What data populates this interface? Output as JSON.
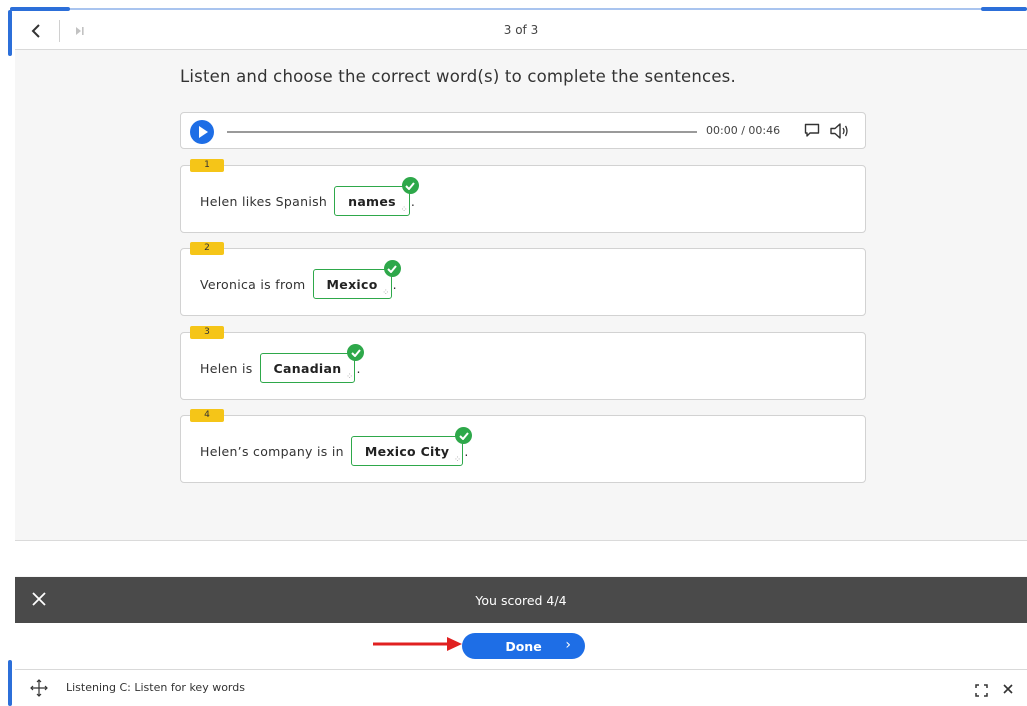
{
  "nav": {
    "back_icon": "chevron-left-icon",
    "skip_icon": "skip-forward-icon",
    "counter": "3 of 3"
  },
  "instruction": "Listen and choose the correct word(s) to complete the sentences.",
  "audio": {
    "time": "00:00 / 00:46",
    "progress": 0,
    "play_icon": "play-icon",
    "subtitle_icon": "subtitles-icon",
    "volume_icon": "volume-icon"
  },
  "questions": [
    {
      "number": "1",
      "prefix": "Helen likes Spanish",
      "answer": "names",
      "suffix": ".",
      "correct": true
    },
    {
      "number": "2",
      "prefix": "Veronica is from",
      "answer": "Mexico",
      "suffix": ".",
      "correct": true
    },
    {
      "number": "3",
      "prefix": "Helen is",
      "answer": "Canadian",
      "suffix": ".",
      "correct": true
    },
    {
      "number": "4",
      "prefix": "Helen’s company is in",
      "answer": "Mexico City",
      "suffix": ".",
      "correct": true
    }
  ],
  "score": {
    "text": "You scored 4/4",
    "close_icon": "close-icon"
  },
  "done": {
    "label": "Done",
    "chevron_icon": "chevron-right-icon"
  },
  "footer": {
    "title": "Listening C: Listen for key words",
    "move_icon": "move-icon",
    "expand_icon": "expand-icon",
    "close_icon": "close-icon"
  },
  "colors": {
    "accent": "#1e6ee6",
    "correct": "#2ea84a",
    "badge": "#f5c518",
    "score_bar": "#4a4a4a",
    "annotation_arrow": "#e02020"
  }
}
